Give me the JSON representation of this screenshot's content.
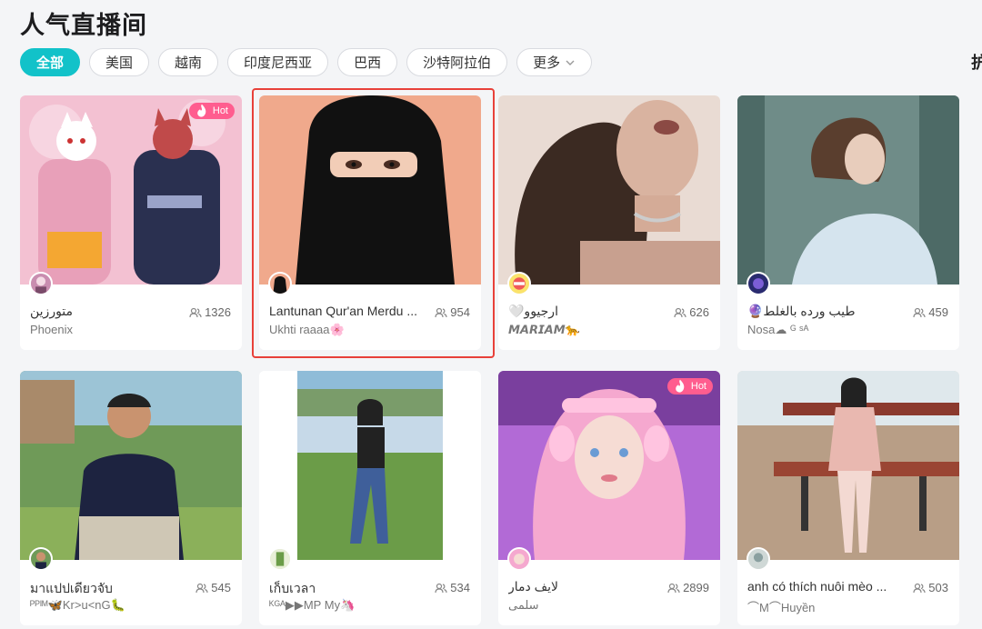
{
  "page_title": "人气直播间",
  "filters": [
    {
      "label": "全部",
      "active": true
    },
    {
      "label": "美国",
      "active": false
    },
    {
      "label": "越南",
      "active": false
    },
    {
      "label": "印度尼西亚",
      "active": false
    },
    {
      "label": "巴西",
      "active": false
    },
    {
      "label": "沙特阿拉伯",
      "active": false
    },
    {
      "label": "更多",
      "active": false
    }
  ],
  "edge_glyph": "护",
  "hot_label": "Hot",
  "cards": [
    {
      "title": "متورزين",
      "viewers": "1326",
      "subtitle": "Phoenix",
      "hot": true,
      "theme": "#f2b8cc"
    },
    {
      "title": "Lantunan Qur'an Merdu ...",
      "viewers": "954",
      "subtitle": "Ukhti raaaa🌸",
      "hot": false,
      "theme": "#f0a98c"
    },
    {
      "title": "ارجيوو🤍",
      "viewers": "626",
      "subtitle": "𝙈𝘼𝙍𝙄𝘼𝙈🐆",
      "hot": false,
      "theme": "#8d6f5c"
    },
    {
      "title": "طيب ورده بالغلط🔮",
      "viewers": "459",
      "subtitle": "Nosa☁ ᴳ ˢᴬ",
      "hot": false,
      "theme": "#5c7f86"
    },
    {
      "title": "มาแปปเดียวจับ",
      "viewers": "545",
      "subtitle": "ᴾᴾᴵᴹ🦋Kr>u<nG🐛",
      "hot": false,
      "theme": "#5c8a4a"
    },
    {
      "title": "เก็บเวลา",
      "viewers": "534",
      "subtitle": "ᴷᴳᴬ▶▶MP My🦄",
      "hot": false,
      "theme": "#7bb1cf"
    },
    {
      "title": "لايف دمار",
      "viewers": "2899",
      "subtitle": "سلمى",
      "hot": true,
      "theme": "#e6a4d4"
    },
    {
      "title": "anh có thích nuôi mèo ...",
      "viewers": "503",
      "subtitle": "⌒M⌒Huyền",
      "hot": false,
      "theme": "#c9b8a6"
    }
  ]
}
